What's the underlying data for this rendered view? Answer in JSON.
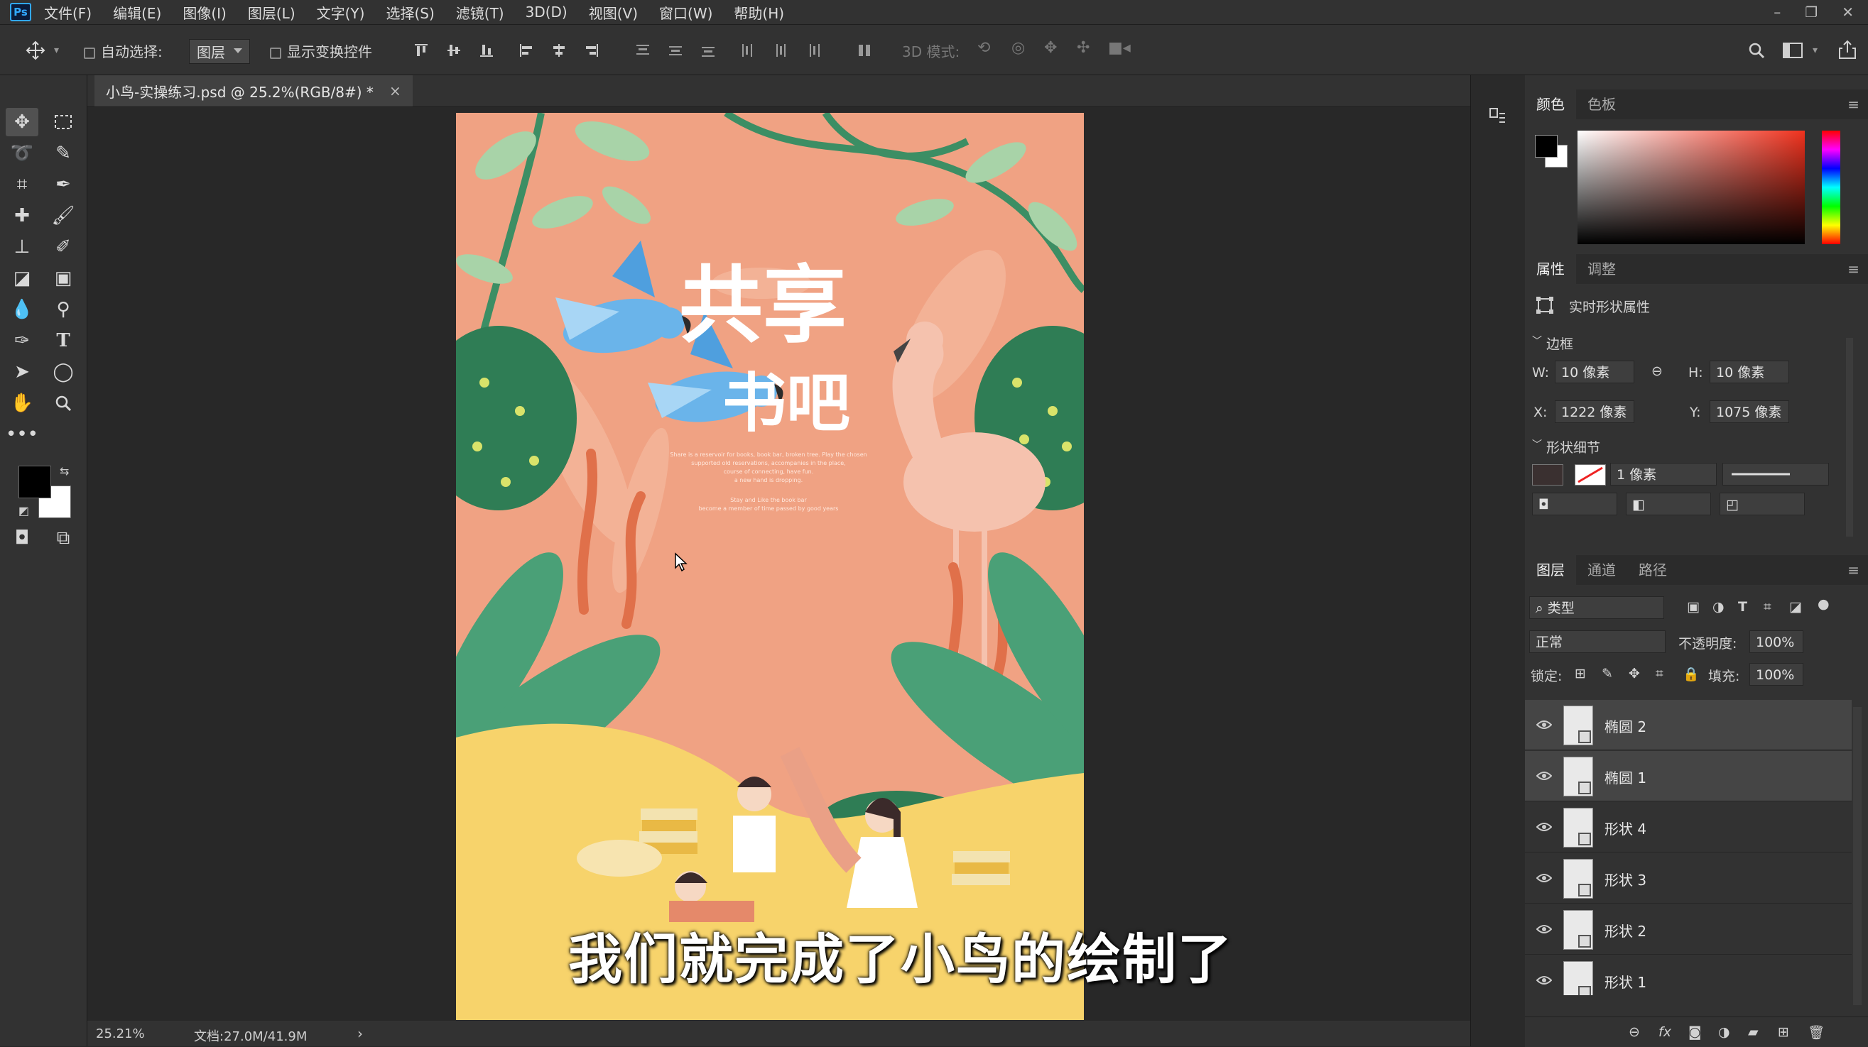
{
  "menubar": {
    "logo": "Ps",
    "items": [
      "文件(F)",
      "编辑(E)",
      "图像(I)",
      "图层(L)",
      "文字(Y)",
      "选择(S)",
      "滤镜(T)",
      "3D(D)",
      "视图(V)",
      "窗口(W)",
      "帮助(H)"
    ],
    "window_controls": [
      "–",
      "❐",
      "✕"
    ]
  },
  "options": {
    "auto_select_label": "自动选择:",
    "auto_select_target": "图层",
    "show_transform_label": "显示变换控件",
    "mode_3d_label": "3D 模式:"
  },
  "document": {
    "tab_title": "小鸟-实操练习.psd @ 25.2%(RGB/8#) *",
    "tab_close": "×",
    "zoom": "25.21%",
    "doc_size": "文档:27.0M/41.9M",
    "status_arrow": "›"
  },
  "poster": {
    "title_line1": "共享",
    "title_line2": "书吧",
    "body_lines": [
      "Share is a reservoir for books, book bar, broken tree. Play the chosen",
      "supported old reservations, accompanies in the place,",
      "course of connecting, have fun.",
      "a new hand is dropping.",
      "Stay and Like the book bar",
      "become a member of time passed by good years"
    ]
  },
  "subtitle": "我们就完成了小鸟的绘制了",
  "color_panel": {
    "tabs": [
      "颜色",
      "色板"
    ],
    "foreground": "#000000",
    "background": "#ffffff",
    "field_hue": "#f0321e"
  },
  "properties_panel": {
    "tabs": [
      "属性",
      "调整"
    ],
    "live_shape_label": "实时形状属性",
    "section_transform": "边框",
    "w_label": "W:",
    "w_value": "10 像素",
    "h_label": "H:",
    "h_value": "10 像素",
    "x_label": "X:",
    "x_value": "1222 像素",
    "y_label": "Y:",
    "y_value": "1075 像素",
    "section_shape": "形状细节",
    "stroke_width": "1 像素",
    "fill_color": "#3a3030"
  },
  "layers_panel": {
    "tabs": [
      "图层",
      "通道",
      "路径"
    ],
    "filter_label": "类型",
    "blend_mode": "正常",
    "opacity_label": "不透明度:",
    "opacity_value": "100%",
    "lock_label": "锁定:",
    "fill_label": "填充:",
    "fill_value": "100%",
    "layers": [
      {
        "name": "椭圆 2",
        "selected": true
      },
      {
        "name": "椭圆 1",
        "selected": true
      },
      {
        "name": "形状 4",
        "selected": false
      },
      {
        "name": "形状 3",
        "selected": false
      },
      {
        "name": "形状 2",
        "selected": false
      },
      {
        "name": "形状 1",
        "selected": false
      }
    ]
  },
  "colors": {
    "accent": "#31a8ff",
    "poster_bg": "#f0a283",
    "poster_sand": "#f7d36b",
    "poster_leaf": "#3f9a6c"
  }
}
